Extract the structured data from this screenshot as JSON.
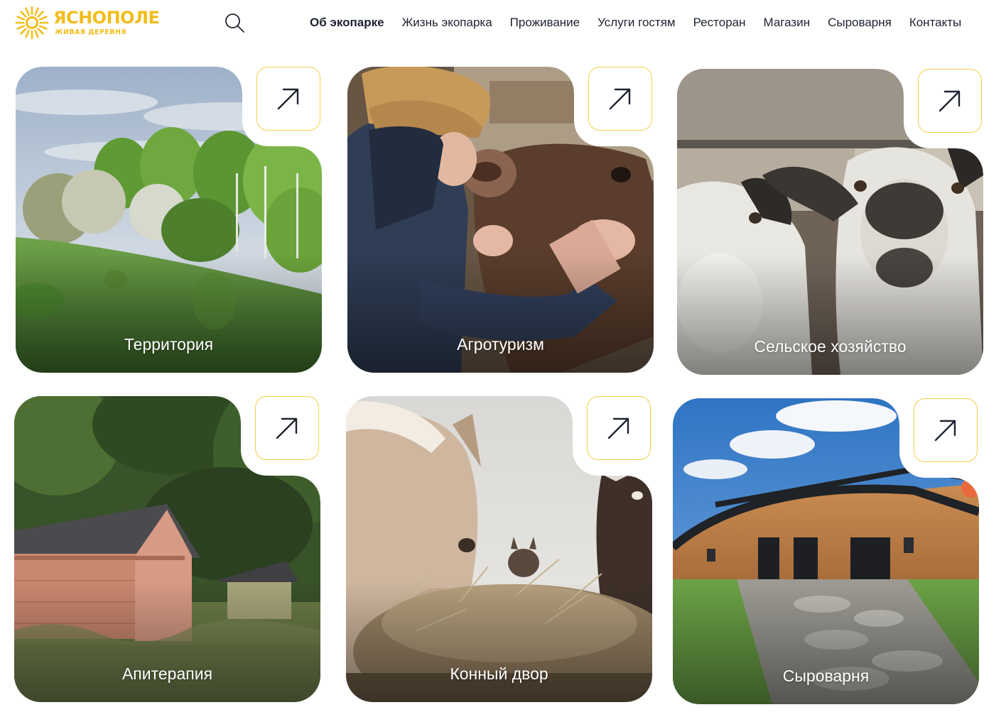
{
  "brand": {
    "name": "ЯСНОПОЛЕ",
    "tagline": "ЖИВАЯ ДЕРЕВНЯ",
    "color": "#f2bd1d"
  },
  "header": {
    "search_icon": "search-icon"
  },
  "nav": {
    "items": [
      {
        "label": "Об экопарке",
        "active": true
      },
      {
        "label": "Жизнь экопарка",
        "active": false
      },
      {
        "label": "Проживание",
        "active": false
      },
      {
        "label": "Услуги гостям",
        "active": false
      },
      {
        "label": "Ресторан",
        "active": false
      },
      {
        "label": "Магазин",
        "active": false
      },
      {
        "label": "Сыроварня",
        "active": false
      },
      {
        "label": "Контакты",
        "active": false
      }
    ]
  },
  "cards": [
    {
      "label": "Территория",
      "photo": "green meadow with blossoming trees",
      "icon": "arrow-up-right-icon"
    },
    {
      "label": "Агротуризм",
      "photo": "woman in a helmet touching a cow",
      "icon": "arrow-up-right-icon"
    },
    {
      "label": "Сельское хозяйство",
      "photo": "goats looking into the camera",
      "icon": "arrow-up-right-icon"
    },
    {
      "label": "Апитерапия",
      "photo": "wooden beehive houses near the forest",
      "icon": "arrow-up-right-icon"
    },
    {
      "label": "Конный двор",
      "photo": "horses eating hay",
      "icon": "arrow-up-right-icon"
    },
    {
      "label": "Сыроварня",
      "photo": "wooden cheese dairy building with stone path",
      "icon": "arrow-up-right-icon"
    }
  ],
  "colors": {
    "accent": "#f2bd1d",
    "arrow_border": "#f3cf4a",
    "text": "#1d2330"
  }
}
